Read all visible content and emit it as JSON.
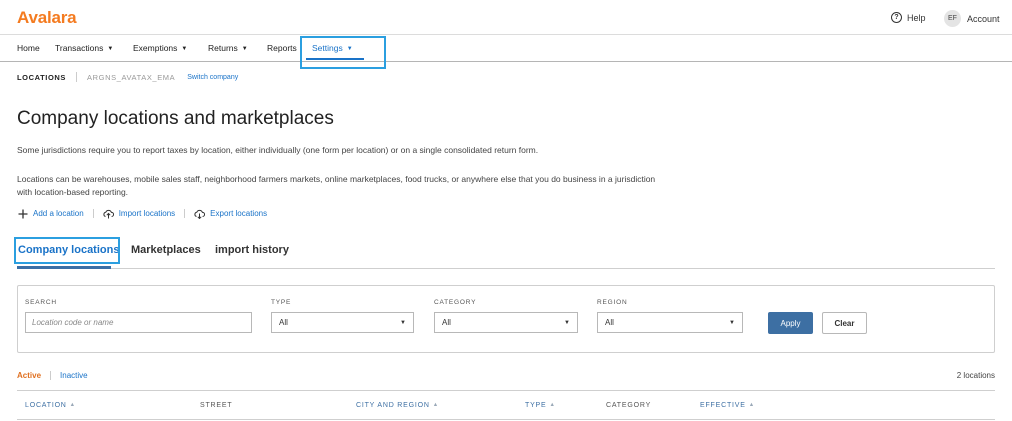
{
  "app": {
    "logo": "Avalara",
    "help_label": "Help",
    "avatar_initials": "EF",
    "account_label": "Account"
  },
  "nav": {
    "home": "Home",
    "transactions": "Transactions",
    "exemptions": "Exemptions",
    "returns": "Returns",
    "reports": "Reports",
    "settings": "Settings"
  },
  "breadcrumb": {
    "section": "LOCATIONS",
    "company": "ARGNS_AVATAX_EMA",
    "switch": "Switch company"
  },
  "page": {
    "title": "Company locations and marketplaces",
    "description_1": "Some jurisdictions require you to report taxes by location, either individually (one form per location) or on a single consolidated return form.",
    "description_2": "Locations can be warehouses, mobile sales staff, neighborhood farmers markets, online marketplaces, food trucks, or anywhere else that you do business in a jurisdiction with location-based reporting."
  },
  "actions": {
    "add": "Add a location",
    "import": "Import locations",
    "export": "Export locations"
  },
  "tabs": {
    "company_locations": "Company locations",
    "marketplaces": "Marketplaces",
    "import_history": "import history"
  },
  "filters": {
    "search_label": "SEARCH",
    "search_placeholder": "Location code or name",
    "type_label": "TYPE",
    "type_value": "All",
    "category_label": "CATEGORY",
    "category_value": "All",
    "region_label": "REGION",
    "region_value": "All",
    "apply": "Apply",
    "clear": "Clear"
  },
  "status": {
    "active": "Active",
    "inactive": "Inactive",
    "count": "2 locations"
  },
  "table": {
    "columns": {
      "location": "LOCATION",
      "street": "STREET",
      "city_region": "CITY AND REGION",
      "type": "TYPE",
      "category": "CATEGORY",
      "effective": "EFFECTIVE"
    }
  },
  "colors": {
    "brand": "#f47b20",
    "link": "#1a73c8",
    "primary_button": "#3d6fa3",
    "highlight": "#2b9fe0"
  }
}
